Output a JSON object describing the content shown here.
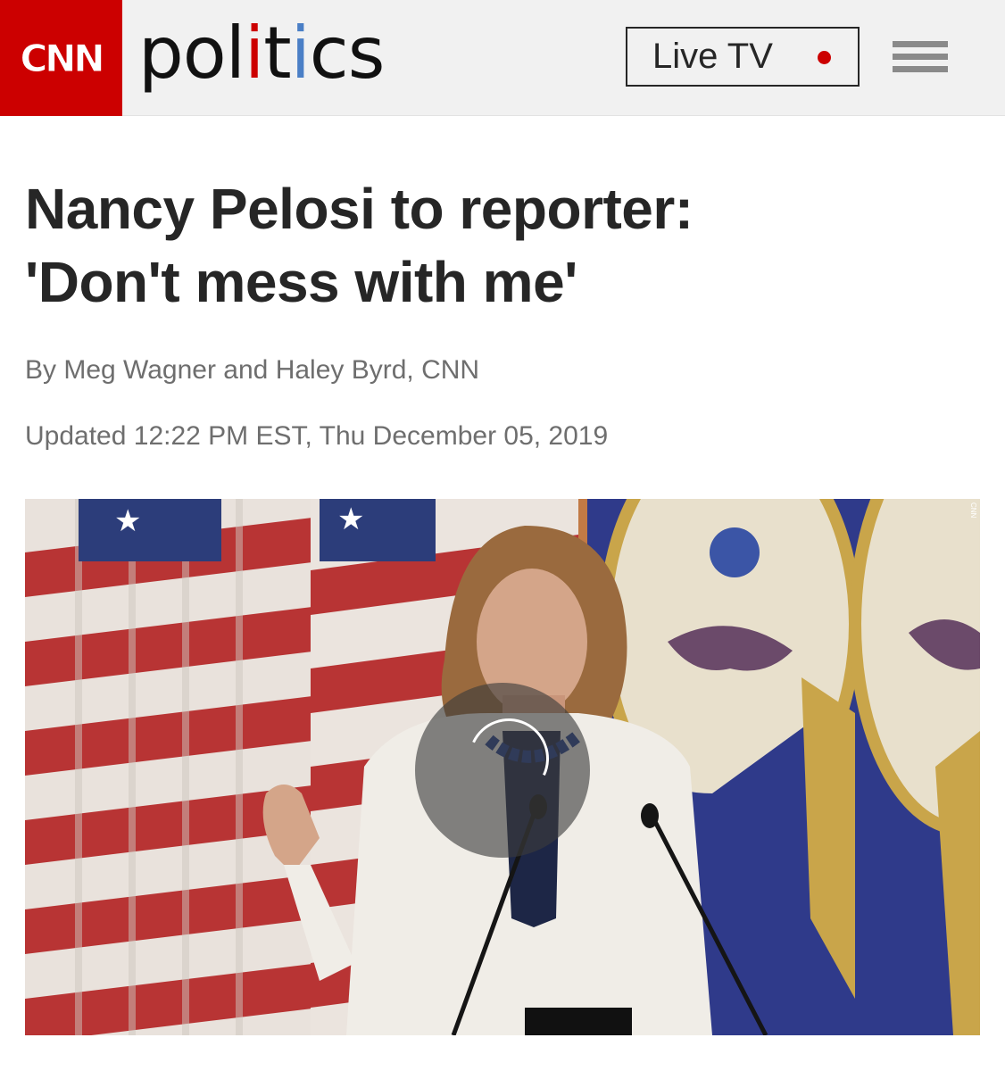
{
  "header": {
    "logo_text": "CNN",
    "section": {
      "p1": "pol",
      "i1": "i",
      "t": "t",
      "i2": "i",
      "rest": "cs"
    },
    "live_label": "Live TV",
    "menu_icon": "hamburger-menu-icon",
    "colors": {
      "brand_red": "#cc0000",
      "section_i_blue": "#4a7fc6"
    }
  },
  "article": {
    "headline_line1": "Nancy Pelosi to reporter:",
    "headline_line2": "'Don't mess with me'",
    "byline": "By Meg Wagner and Haley Byrd, CNN",
    "timestamp": "Updated 12:22 PM EST, Thu December 05, 2019"
  },
  "video": {
    "watermark": "CNN",
    "spinner_icon": "loading-spinner-icon"
  }
}
